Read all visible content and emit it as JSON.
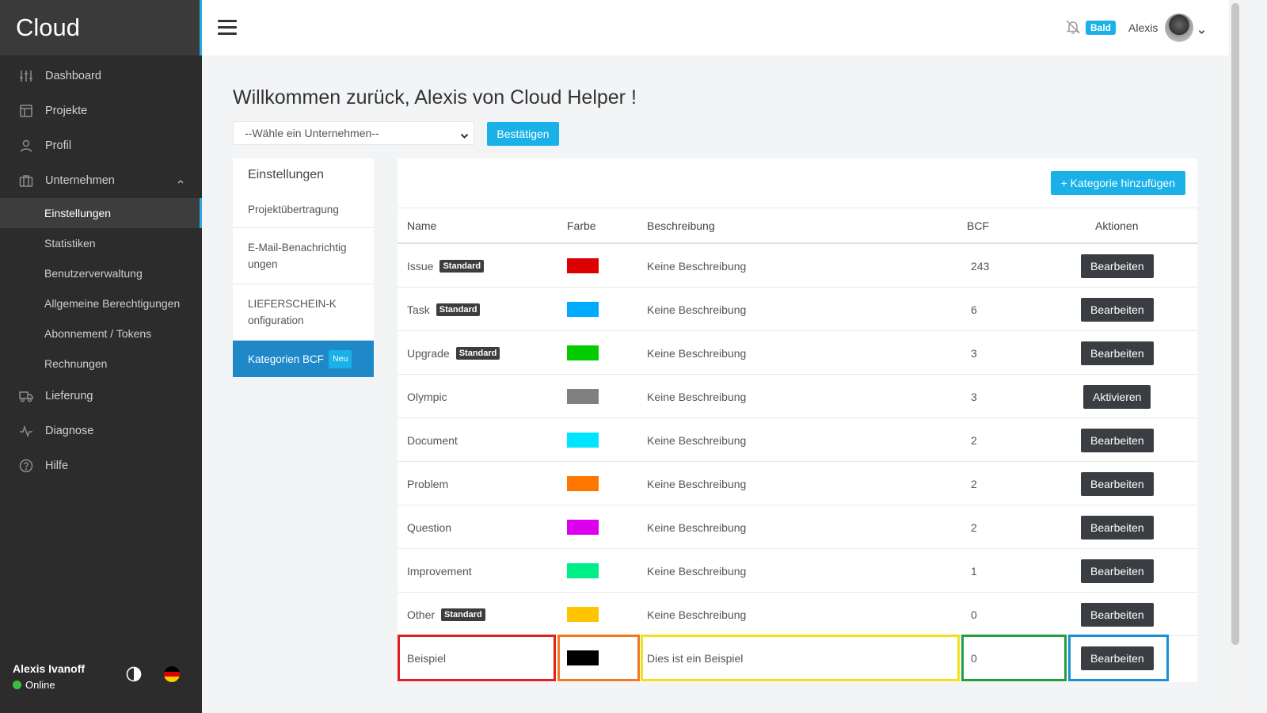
{
  "app": {
    "brand": "Cloud"
  },
  "sidebar": {
    "items": [
      {
        "label": "Dashboard",
        "icon": "sliders-icon"
      },
      {
        "label": "Projekte",
        "icon": "layout-icon"
      },
      {
        "label": "Profil",
        "icon": "user-icon"
      },
      {
        "label": "Unternehmen",
        "icon": "briefcase-icon",
        "expanded": true
      }
    ],
    "subitems": [
      {
        "label": "Einstellungen",
        "active": true
      },
      {
        "label": "Statistiken"
      },
      {
        "label": "Benutzerverwaltung"
      },
      {
        "label": "Allgemeine Berechtigungen"
      },
      {
        "label": "Abonnement / Tokens"
      },
      {
        "label": "Rechnungen"
      }
    ],
    "bottom_items": [
      {
        "label": "Lieferung",
        "icon": "truck-icon"
      },
      {
        "label": "Diagnose",
        "icon": "activity-icon"
      },
      {
        "label": "Hilfe",
        "icon": "help-icon"
      }
    ],
    "footer": {
      "user": "Alexis Ivanoff",
      "status": "Online",
      "status_color": "#3cc03c"
    }
  },
  "topbar": {
    "badge": "Bald",
    "user": "Alexis"
  },
  "main": {
    "welcome": "Willkommen zurück, Alexis von Cloud Helper !",
    "company_select": {
      "selected": "--Wähle ein Unternehmen--"
    },
    "confirm_label": "Bestätigen"
  },
  "settings": {
    "title": "Einstellungen",
    "items": [
      {
        "label": "Projektübertragung"
      },
      {
        "label": "E-Mail-Benachrichtigungen"
      },
      {
        "label": "LIEFERSCHEIN-Konfiguration"
      },
      {
        "label": "Kategorien BCF",
        "badge": "Neu",
        "active": true
      }
    ]
  },
  "categories": {
    "add_label": "+ Kategorie hinzufügen",
    "headers": {
      "name": "Name",
      "color": "Farbe",
      "description": "Beschreibung",
      "bcf": "BCF",
      "actions": "Aktionen"
    },
    "rows": [
      {
        "name": "Issue",
        "standard": "Standard",
        "color": "#dd0000",
        "description": "Keine Beschreibung",
        "bcf": "243",
        "action": "Bearbeiten"
      },
      {
        "name": "Task",
        "standard": "Standard",
        "color": "#00aaff",
        "description": "Keine Beschreibung",
        "bcf": "6",
        "action": "Bearbeiten"
      },
      {
        "name": "Upgrade",
        "standard": "Standard",
        "color": "#00cc00",
        "description": "Keine Beschreibung",
        "bcf": "3",
        "action": "Bearbeiten"
      },
      {
        "name": "Olympic",
        "standard": "",
        "color": "#808080",
        "description": "Keine Beschreibung",
        "bcf": "3",
        "action": "Aktivieren"
      },
      {
        "name": "Document",
        "standard": "",
        "color": "#00e5ff",
        "description": "Keine Beschreibung",
        "bcf": "2",
        "action": "Bearbeiten"
      },
      {
        "name": "Problem",
        "standard": "",
        "color": "#ff7700",
        "description": "Keine Beschreibung",
        "bcf": "2",
        "action": "Bearbeiten"
      },
      {
        "name": "Question",
        "standard": "",
        "color": "#dd00ee",
        "description": "Keine Beschreibung",
        "bcf": "2",
        "action": "Bearbeiten"
      },
      {
        "name": "Improvement",
        "standard": "",
        "color": "#00ee88",
        "description": "Keine Beschreibung",
        "bcf": "1",
        "action": "Bearbeiten"
      },
      {
        "name": "Other",
        "standard": "Standard",
        "color": "#ffc400",
        "description": "Keine Beschreibung",
        "bcf": "0",
        "action": "Bearbeiten"
      },
      {
        "name": "Beispiel",
        "standard": "",
        "color": "#000000",
        "description": "Dies ist ein Beispiel",
        "bcf": "0",
        "action": "Bearbeiten"
      }
    ],
    "highlight_colors": {
      "name": "#e02020",
      "color": "#f07820",
      "description": "#f0e020",
      "bcf": "#20a040",
      "actions": "#1a90d0"
    }
  }
}
